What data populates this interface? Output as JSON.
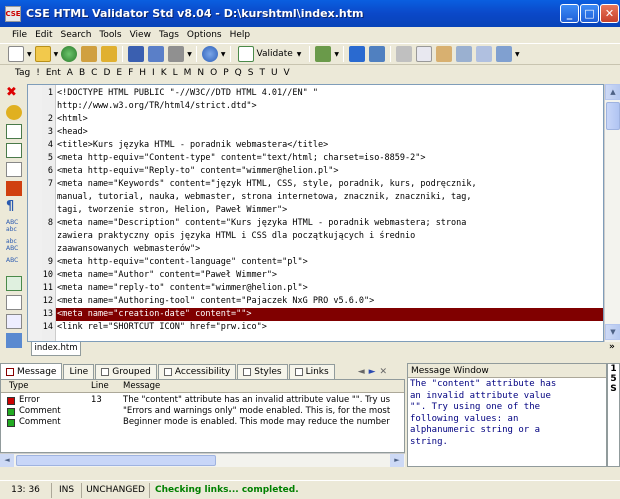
{
  "window": {
    "title": "CSE HTML Validator Std v8.04 - D:\\kurshtml\\index.htm"
  },
  "menu": [
    "File",
    "Edit",
    "Search",
    "Tools",
    "View",
    "Tags",
    "Options",
    "Help"
  ],
  "toolbar": {
    "validate_label": "Validate"
  },
  "tagbar": [
    "Tag",
    "!",
    "Ent",
    "A",
    "B",
    "C",
    "D",
    "E",
    "F",
    "H",
    "I",
    "K",
    "L",
    "M",
    "N",
    "O",
    "P",
    "Q",
    "S",
    "T",
    "U",
    "V"
  ],
  "editor": {
    "lines": [
      {
        "num": "1",
        "text": "<!DOCTYPE HTML PUBLIC \"-//W3C//DTD HTML 4.01//EN\" \""
      },
      {
        "num": "",
        "text": "http://www.w3.org/TR/html4/strict.dtd\">"
      },
      {
        "num": "2",
        "text": "<html>"
      },
      {
        "num": "3",
        "text": "<head>"
      },
      {
        "num": "4",
        "text": "<title>Kurs języka HTML - poradnik webmastera</title>"
      },
      {
        "num": "5",
        "text": "<meta http-equiv=\"Content-type\" content=\"text/html; charset=iso-8859-2\">"
      },
      {
        "num": "6",
        "text": "<meta http-equiv=\"Reply-to\" content=\"wimmer@helion.pl\">"
      },
      {
        "num": "7",
        "text": "<meta name=\"Keywords\" content=\"język HTML, CSS, style, poradnik, kurs, podręcznik,"
      },
      {
        "num": "",
        "text": "manual, tutorial, nauka, webmaster, strona internetowa, znacznik, znaczniki, tag,"
      },
      {
        "num": "",
        "text": "tagi, tworzenie stron, Helion, Paweł Wimmer\">"
      },
      {
        "num": "8",
        "text": "<meta name=\"Description\" content=\"Kurs języka HTML - poradnik webmastera; strona"
      },
      {
        "num": "",
        "text": "zawiera praktyczny opis języka HTML i CSS dla początkujących i średnio"
      },
      {
        "num": "",
        "text": "zaawansowanych webmasterów\">"
      },
      {
        "num": "9",
        "text": "<meta http-equiv=\"content-language\" content=\"pl\">"
      },
      {
        "num": "10",
        "text": "<meta name=\"Author\" content=\"Paweł Wimmer\">"
      },
      {
        "num": "11",
        "text": "<meta name=\"reply-to\" content=\"wimmer@helion.pl\">"
      },
      {
        "num": "12",
        "text": "<meta name=\"Authoring-tool\" content=\"Pajaczek NxG PRO v5.6.0\">"
      },
      {
        "num": "13",
        "text": "<meta name=\"creation-date\" content=\"\">"
      },
      {
        "num": "14",
        "text": "<link rel=\"SHORTCUT ICON\" href=\"prw.ico\">"
      }
    ],
    "highlight_line": "13"
  },
  "file_tab": "index.htm",
  "bottom_tabs": [
    "Message",
    "Line",
    "Grouped",
    "Accessibility",
    "Styles",
    "Links"
  ],
  "messages": {
    "headers": [
      "Type",
      "Line",
      "Message"
    ],
    "rows": [
      {
        "type": "Error",
        "line": "13",
        "message": "The \"content\" attribute has an invalid attribute value \"\". Try us",
        "color": "#cc0000"
      },
      {
        "type": "Comment",
        "line": "",
        "message": "\"Errors and warnings only\" mode enabled. This is, for the most",
        "color": "#22aa22"
      },
      {
        "type": "Comment",
        "line": "",
        "message": "Beginner mode is enabled. This mode may reduce the number",
        "color": "#22aa22"
      }
    ]
  },
  "message_window": {
    "title": "Message Window",
    "text": "The \"content\" attribute has\nan invalid attribute value\n\"\". Try using one of the\nfollowing values: an\nalphanumeric string or a\nstring."
  },
  "side_letters": [
    "1",
    "5",
    "S"
  ],
  "status": {
    "pos": "13: 36",
    "mode": "INS",
    "state": "UNCHANGED",
    "message": "Checking links... completed.",
    "message_color": "#008000"
  }
}
